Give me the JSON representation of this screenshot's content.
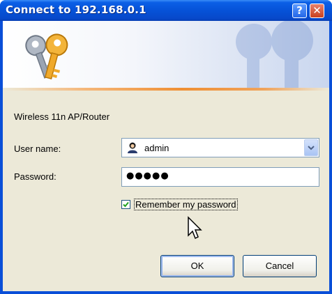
{
  "window": {
    "title": "Connect to 192.168.0.1"
  },
  "titlebar": {
    "help_glyph": "?",
    "close_glyph": "✕"
  },
  "dialog": {
    "realm": "Wireless 11n AP/Router",
    "username_label": "User name:",
    "password_label": "Password:",
    "username_value": "admin",
    "password_masked": "●●●●●",
    "remember_label": "Remember my password",
    "remember_checked": true,
    "ok_label": "OK",
    "cancel_label": "Cancel"
  },
  "icons": {
    "banner": "keys-icon",
    "user": "user-icon",
    "dropdown": "chevron-down-icon",
    "check": "checkmark-icon",
    "cursor": "mouse-cursor-icon"
  },
  "colors": {
    "titlebar_blue": "#0652d8",
    "dialog_bg": "#ece9d8",
    "accent_orange": "#ef8f34"
  }
}
